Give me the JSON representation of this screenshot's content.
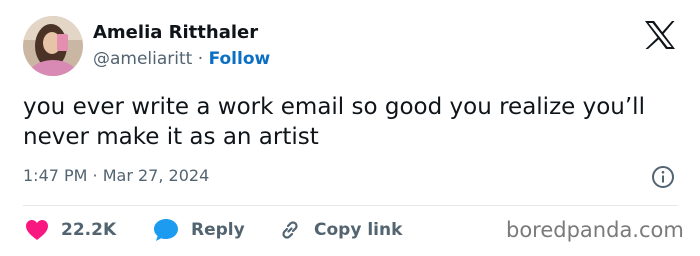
{
  "author": {
    "name": "Amelia Ritthaler",
    "handle": "@ameliaritt",
    "separator": "·",
    "follow_label": "Follow"
  },
  "icons": {
    "brand": "x-logo-icon",
    "info": "info-icon",
    "like": "heart-icon",
    "reply": "reply-bubble-icon",
    "copy_link": "link-icon"
  },
  "tweet": {
    "text": "you ever write a work email so good you realize you’ll never make it as an artist",
    "timestamp": "1:47 PM · Mar 27, 2024"
  },
  "actions": {
    "likes_count": "22.2K",
    "reply_label": "Reply",
    "copy_link_label": "Copy link"
  },
  "watermark": "boredpanda.com",
  "colors": {
    "text": "#0f1419",
    "muted": "#536471",
    "follow": "#0b6fc4",
    "like": "#f91880",
    "reply": "#1d9bf0",
    "divider": "#e6e9ec"
  }
}
